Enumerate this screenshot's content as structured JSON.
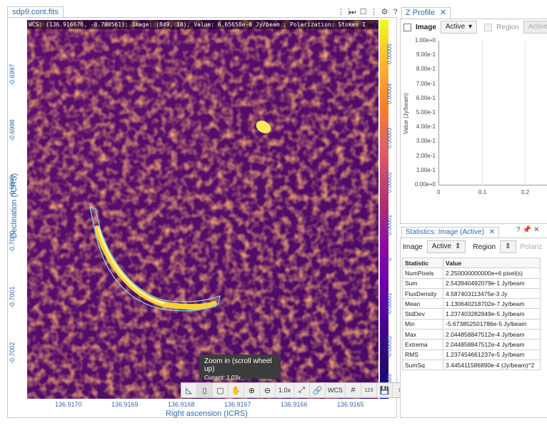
{
  "viewer": {
    "tab_title": "sdp9.cont.fits",
    "cursor_info": "WCS: (136.916676, -0.700561); Image: (849, 10); Value:  6.65658e-6 Jy/beam ; Polarization: Stokes I",
    "x_axis_label": "Right ascension (ICRS)",
    "y_axis_label": "Declination (ICRS)",
    "x_ticks": [
      "136.9170",
      "136.9169",
      "136.9168",
      "136.9167",
      "136.9166",
      "136.9165"
    ],
    "y_ticks": [
      "-0.6997",
      "-0.6998",
      "-0.6999",
      "-0.7000",
      "-0.7001",
      "-0.7002"
    ],
    "colorbar_ticks": [
      "0.00005",
      "0.00004",
      "0.00003",
      "0.00002",
      "0.00001",
      "0",
      "-0.00001",
      "-0.00002",
      "-0.00003"
    ],
    "toolbar": {
      "zoom_level": "1.0x",
      "wcs_label": "WCS",
      "grid_label": "#",
      "label_123": "123"
    },
    "tooltip": {
      "title": "Zoom in (scroll wheel up)",
      "current": "Current: 1.03x"
    }
  },
  "z_profile": {
    "tab_title": "Z Profile",
    "image_label": "Image",
    "image_value": "Active",
    "region_label": "Region",
    "region_value": "Active",
    "y_axis_label": "Value (Jy/beam)",
    "y_ticks": [
      "1.00e+0",
      "9.00e-1",
      "8.00e-1",
      "7.00e-1",
      "6.00e-1",
      "5.00e-1",
      "4.00e-1",
      "3.00e-1",
      "2.00e-1",
      "1.00e-1",
      "0.00e+0"
    ],
    "x_ticks": [
      "0",
      "0.1",
      "0.2"
    ]
  },
  "statistics": {
    "tab_title": "Statistics: Image (Active)",
    "image_label": "Image",
    "image_value": "Active",
    "region_label": "Region",
    "polarization_label": "Polariz",
    "headers": [
      "Statistic",
      "Value"
    ],
    "rows": [
      [
        "NumPixels",
        "2.250000000000e+6 pixel(s)"
      ],
      [
        "Sum",
        "2.543940492079e-1 Jy/beam"
      ],
      [
        "FluxDensity",
        "4.587403113475e-3 Jy"
      ],
      [
        "Mean",
        "1.130640218702e-7 Jy/beam"
      ],
      [
        "StdDev",
        "1.237403282849e-5 Jy/beam"
      ],
      [
        "Min",
        "-5.673852501786e-5 Jy/beam"
      ],
      [
        "Max",
        "2.044858847512e-4 Jy/beam"
      ],
      [
        "Extrema",
        "2.044858847512e-4 Jy/beam"
      ],
      [
        "RMS",
        "1.237454661237e-5 Jy/beam"
      ],
      [
        "SumSq",
        "3.445411586890e-4 (Jy/beam)^2"
      ]
    ]
  },
  "colors": {
    "accent": "#2f6bb0",
    "region_outline": "#7fd6e6"
  }
}
